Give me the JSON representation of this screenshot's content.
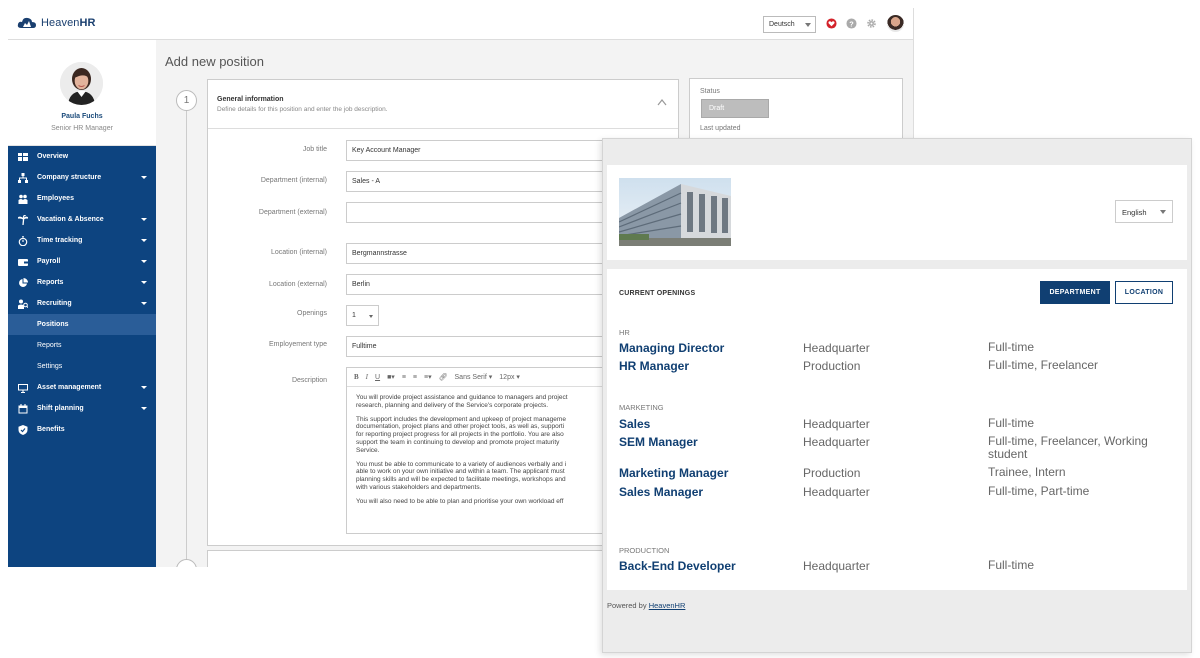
{
  "admin": {
    "brand": "HeavenHR",
    "brand_light": "Heaven",
    "brand_bold": "HR",
    "language_select": "Deutsch",
    "profile": {
      "name": "Paula Fuchs",
      "role": "Senior HR Manager"
    },
    "nav": [
      {
        "label": "Overview",
        "icon": "grid-icon",
        "expandable": false
      },
      {
        "label": "Company structure",
        "icon": "org-chart-icon",
        "expandable": true
      },
      {
        "label": "Employees",
        "icon": "people-icon",
        "expandable": false
      },
      {
        "label": "Vacation & Absence",
        "icon": "palm-tree-icon",
        "expandable": true
      },
      {
        "label": "Time tracking",
        "icon": "stopwatch-icon",
        "expandable": true
      },
      {
        "label": "Payroll",
        "icon": "wallet-icon",
        "expandable": true
      },
      {
        "label": "Reports",
        "icon": "pie-chart-icon",
        "expandable": true
      },
      {
        "label": "Recruiting",
        "icon": "recruiting-icon",
        "expandable": true
      }
    ],
    "recruiting_sub": [
      "Positions",
      "Reports",
      "Settings"
    ],
    "nav_bottom": [
      {
        "label": "Asset management",
        "icon": "monitor-icon",
        "expandable": true
      },
      {
        "label": "Shift planning",
        "icon": "calendar-icon",
        "expandable": true
      },
      {
        "label": "Benefits",
        "icon": "shield-icon",
        "expandable": false
      }
    ],
    "page_title": "Add new position",
    "step_number": "1",
    "section": {
      "title": "General information",
      "description": "Define details for this position and enter the job description."
    },
    "fields": {
      "job_title": {
        "label": "Job title",
        "value": "Key Account Manager"
      },
      "department_internal": {
        "label": "Department (internal)",
        "value": "Sales - A"
      },
      "department_external": {
        "label": "Department (external)",
        "value": ""
      },
      "location_internal": {
        "label": "Location (internal)",
        "value": "Bergmannstrasse"
      },
      "location_external": {
        "label": "Location (external)",
        "value": "Berlin"
      },
      "openings": {
        "label": "Openings",
        "value": "1"
      },
      "employment_type": {
        "label": "Employement type",
        "value": "Fulltime"
      },
      "description": {
        "label": "Description"
      }
    },
    "editor": {
      "font": "Sans Serif",
      "size": "12px",
      "paragraphs": [
        [
          "You will provide project assistance and guidance to managers and project",
          "research, planning and delivery of the Service's corporate projects."
        ],
        [
          "This support includes the development and upkeep of project manageme",
          "documentation, project plans and other project tools, as well as, supporti",
          "for reporting project progress for all projects in the portfolio. You are also",
          "support the team in continuing to develop and promote project maturity",
          "Service."
        ],
        [
          "You must be able to communicate to a variety of audiences verbally and i",
          "able to work on your own initiative and within a team. The applicant must",
          "planning skills and will be expected to facilitate meetings, workshops and",
          "with various stakeholders and departments."
        ],
        [
          "You will also need to be able to plan and prioritise your own workload eff"
        ]
      ]
    },
    "status": {
      "label": "Status",
      "value": "Draft",
      "updated_label": "Last updated"
    }
  },
  "career": {
    "language_select": "English",
    "openings_title": "CURRENT OPENINGS",
    "filter_department": "DEPARTMENT",
    "filter_location": "LOCATION",
    "departments": [
      {
        "name": "HR",
        "jobs": [
          {
            "title": "Managing Director",
            "location": "Headquarter",
            "type": "Full-time"
          },
          {
            "title": "HR Manager",
            "location": "Production",
            "type": "Full-time, Freelancer"
          }
        ]
      },
      {
        "name": "MARKETING",
        "jobs": [
          {
            "title": "Sales",
            "location": "Headquarter",
            "type": "Full-time"
          },
          {
            "title": "SEM Manager",
            "location": "Headquarter",
            "type": "Full-time, Freelancer, Working student"
          },
          {
            "title": "Marketing Manager",
            "location": "Production",
            "type": "Trainee, Intern"
          },
          {
            "title": "Sales Manager",
            "location": "Headquarter",
            "type": "Full-time, Part-time"
          }
        ]
      },
      {
        "name": "PRODUCTION",
        "jobs": [
          {
            "title": "Back-End Developer",
            "location": "Headquarter",
            "type": "Full-time"
          }
        ]
      }
    ],
    "powered_by": "Powered by",
    "powered_link": "HeavenHR"
  },
  "colors": {
    "navy": "#0d4480",
    "accent_blue": "#103f72",
    "heart_red": "#d3222a"
  }
}
